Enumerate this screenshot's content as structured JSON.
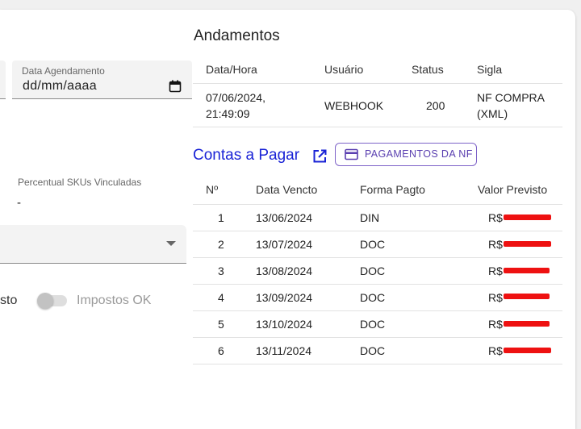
{
  "left": {
    "date_field": {
      "label": "Data Agendamento",
      "value": "dd/mm/aaaa",
      "icon": "calendar-icon"
    },
    "percent_label": "Percentual SKUs Vinculadas",
    "percent_value": "-",
    "select_icon": "caret-down-icon",
    "partial_label": "sto",
    "toggle_label": "Impostos OK"
  },
  "andamentos": {
    "title": "Andamentos",
    "headers": [
      "Data/Hora",
      "Usuário",
      "Status",
      "Sigla"
    ],
    "rows": [
      {
        "datahora": "07/06/2024, 21:49:09",
        "datahora_l1": "07/06/2024,",
        "datahora_l2": "21:49:09",
        "usuario": "WEBHOOK",
        "status": "200",
        "sigla_l1": "NF COMPRA",
        "sigla_l2": "(XML)"
      }
    ]
  },
  "contas": {
    "title": "Contas a Pagar",
    "button_label": "PAGAMENTOS DA NF",
    "headers": [
      "Nº",
      "Data Vencto",
      "Forma Pagto",
      "Valor Previsto"
    ],
    "currency": "R$",
    "rows": [
      {
        "n": "1",
        "data": "13/06/2024",
        "forma": "DIN"
      },
      {
        "n": "2",
        "data": "13/07/2024",
        "forma": "DOC"
      },
      {
        "n": "3",
        "data": "13/08/2024",
        "forma": "DOC"
      },
      {
        "n": "4",
        "data": "13/09/2024",
        "forma": "DOC"
      },
      {
        "n": "5",
        "data": "13/10/2024",
        "forma": "DOC"
      },
      {
        "n": "6",
        "data": "13/11/2024",
        "forma": "DOC"
      }
    ]
  },
  "colors": {
    "link": "#1a23d6",
    "button": "#5a3fb0",
    "redaction": "#ee1111"
  }
}
